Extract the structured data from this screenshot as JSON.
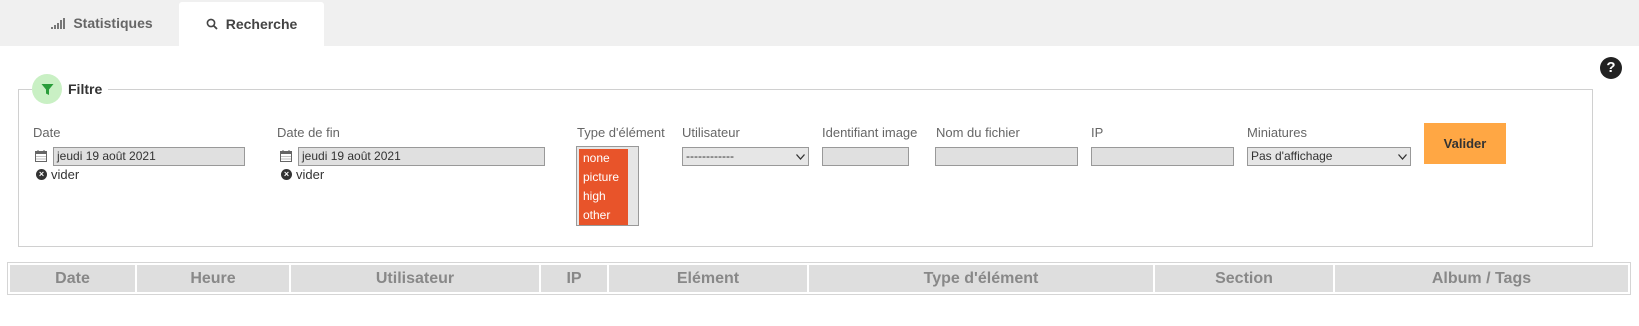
{
  "tabs": [
    {
      "label": "Statistiques",
      "icon": "signal-bars-icon",
      "active": false
    },
    {
      "label": "Recherche",
      "icon": "search-icon",
      "active": true
    }
  ],
  "help": {
    "label": "?"
  },
  "filter": {
    "title": "Filtre",
    "icon": "funnel-icon",
    "date": {
      "label": "Date",
      "value": "jeudi 19 août 2021",
      "clear_label": "vider"
    },
    "date_end": {
      "label": "Date de fin",
      "value": "jeudi 19 août 2021",
      "clear_label": "vider"
    },
    "type": {
      "label": "Type d'élément",
      "options": [
        "none",
        "picture",
        "high",
        "other"
      ],
      "selected_color": "#e8542a"
    },
    "user": {
      "label": "Utilisateur",
      "value": "------------"
    },
    "image_id": {
      "label": "Identifiant image",
      "value": ""
    },
    "filename": {
      "label": "Nom du fichier",
      "value": ""
    },
    "ip": {
      "label": "IP",
      "value": ""
    },
    "thumbnails": {
      "label": "Miniatures",
      "value": "Pas d'affichage"
    },
    "submit_label": "Valider",
    "submit_color": "#ffa744"
  },
  "table": {
    "headers": [
      "Date",
      "Heure",
      "Utilisateur",
      "IP",
      "Elément",
      "Type d'élément",
      "Section",
      "Album / Tags"
    ]
  }
}
